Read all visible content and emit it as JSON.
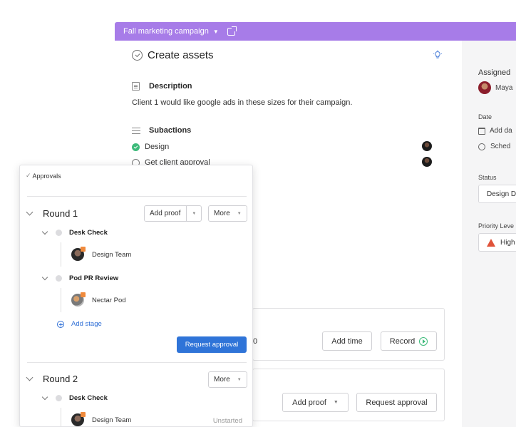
{
  "header": {
    "project": "Fall marketing campaign"
  },
  "task": {
    "title": "Create assets",
    "description_label": "Description",
    "description_text": "Client 1 would like google ads in these sizes for their campaign.",
    "subactions_label": "Subactions",
    "subactions": [
      {
        "label": "Design",
        "done": true
      },
      {
        "label": "Get client approval",
        "done": false
      }
    ]
  },
  "cards": {
    "time": {
      "value_tail": "0",
      "add_time": "Add time",
      "record": "Record"
    },
    "proof": {
      "add_proof": "Add proof",
      "request_approval": "Request approval"
    }
  },
  "right_panel": {
    "assigned_label": "Assigned",
    "assignee": "Maya",
    "date_label": "Date",
    "add_date": "Add da",
    "schedule": "Sched",
    "status_label": "Status",
    "status_value": "Design D",
    "priority_label": "Priority Leve",
    "priority_value": "High"
  },
  "approvals": {
    "title": "Approvals",
    "rounds": [
      {
        "title": "Round 1",
        "add_proof": "Add proof",
        "more": "More",
        "stages": [
          {
            "name": "Desk Check",
            "reviewer": "Design Team"
          },
          {
            "name": "Pod PR Review",
            "reviewer": "Nectar Pod"
          }
        ],
        "add_stage": "Add stage",
        "request_approval": "Request approval"
      },
      {
        "title": "Round 2",
        "more": "More",
        "stages": [
          {
            "name": "Desk Check",
            "reviewer": "Design Team",
            "status": "Unstarted"
          }
        ]
      }
    ]
  },
  "colors": {
    "header": "#a77ce8",
    "primary": "#2f74d8",
    "done": "#3dba7a",
    "priority_high": "#e0533a"
  }
}
